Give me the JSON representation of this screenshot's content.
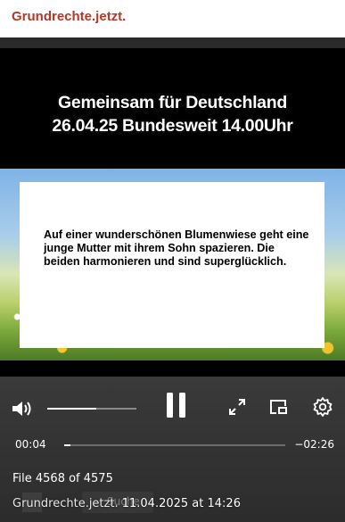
{
  "site": {
    "title": "Grundrechte.jetzt."
  },
  "video": {
    "banner_line1": "Gemeinsam für Deutschland",
    "banner_line2": "26.04.25 Bundesweit 14.00Uhr",
    "caption": "Auf einer wunderschönen Blumenwiese geht eine junge Mutter mit ihrem Sohn spazieren. Die beiden harmonieren und sind superglücklich.",
    "volume_fraction": 0.55,
    "progress_fraction": 0.03
  },
  "player": {
    "time_current": "00:04",
    "time_remaining": "−02:26",
    "file_counter": "File 4568 of 4575",
    "uploader": "Grundrechte.jetzt.",
    "date": "11.04.2025 at 14:26",
    "ghost_search_label": "Suche"
  },
  "icons": {
    "volume": "volume-icon",
    "pause": "pause-icon",
    "fullscreen": "fullscreen-icon",
    "pip": "picture-in-picture-icon",
    "settings": "gear-icon"
  },
  "colors": {
    "site_title": "#b23a2a",
    "controls_bg": "#2c2c2c"
  }
}
